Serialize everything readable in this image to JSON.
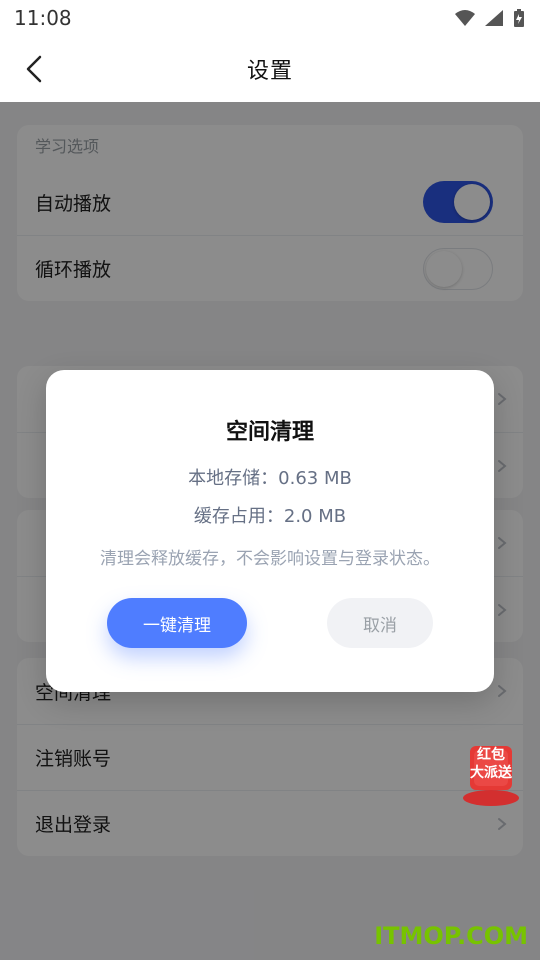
{
  "status": {
    "time": "11:08"
  },
  "header": {
    "title": "设置"
  },
  "sections": {
    "study": {
      "title": "学习选项",
      "rows": [
        {
          "label": "自动播放",
          "toggle": "on"
        },
        {
          "label": "循环播放",
          "toggle": "off"
        }
      ]
    },
    "cleanup": {
      "rows": [
        {
          "label": "空间清理"
        },
        {
          "label": "注销账号"
        },
        {
          "label": "退出登录"
        }
      ]
    }
  },
  "modal": {
    "title": "空间清理",
    "local_storage": "本地存储：0.63 MB",
    "cache_usage": "缓存占用：2.0 MB",
    "note": "清理会释放缓存，不会影响设置与登录状态。",
    "primary": "一键清理",
    "secondary": "取消"
  },
  "promo": {
    "line1": "红包",
    "line2": "大派送"
  },
  "watermark": "ITMOP.COM",
  "colors": {
    "accent": "#2f56e6",
    "button": "#4f7dff"
  }
}
